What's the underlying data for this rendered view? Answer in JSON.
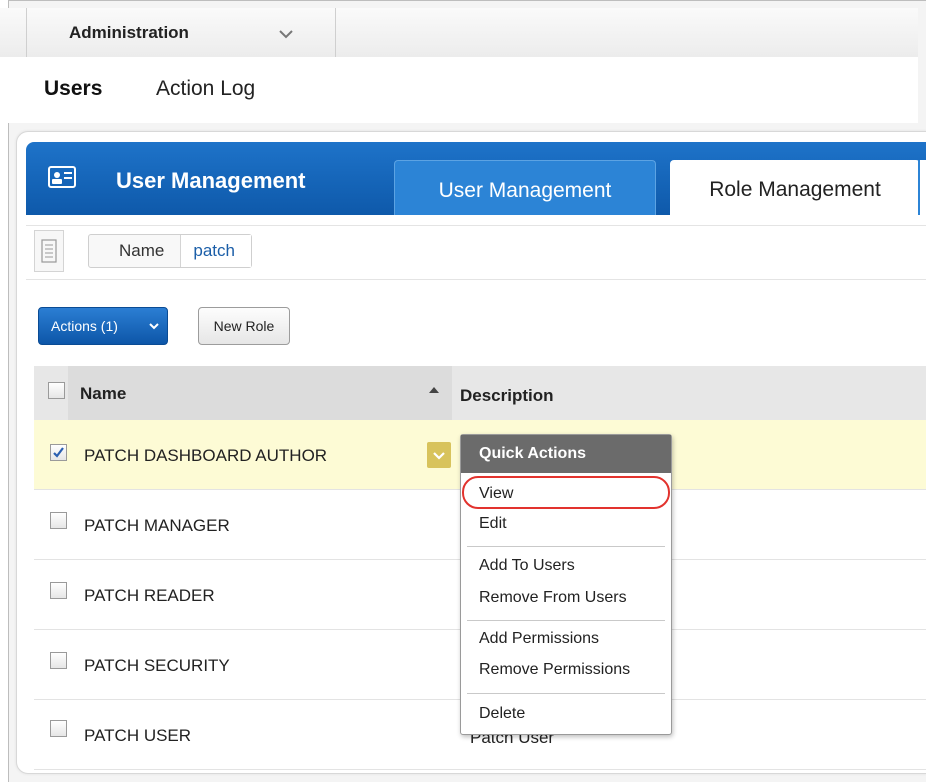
{
  "topbar": {
    "title": "Administration",
    "chevron_icon": "chevron-down-icon"
  },
  "subnav": {
    "tabs": [
      "Users",
      "Action Log"
    ]
  },
  "panel": {
    "title": "User Management",
    "logo_icon": "id-card-icon",
    "tabs": [
      "User Management",
      "Role Management"
    ]
  },
  "filter": {
    "list_icon": "list-icon",
    "key": "Name",
    "value": "patch"
  },
  "toolbar": {
    "actions_label": "Actions (1)",
    "new_role_label": "New Role"
  },
  "table": {
    "headers": [
      "Name",
      "Description"
    ],
    "rows": [
      {
        "name": "PATCH DASHBOARD AUTHOR",
        "description": "",
        "checked": true
      },
      {
        "name": "PATCH MANAGER",
        "description": "",
        "checked": false
      },
      {
        "name": "PATCH READER",
        "description": "",
        "checked": false
      },
      {
        "name": "PATCH SECURITY",
        "description": "",
        "checked": false
      },
      {
        "name": "PATCH USER",
        "description": "Patch User",
        "checked": false
      }
    ]
  },
  "quick_actions": {
    "title": "Quick Actions",
    "items": [
      "View",
      "Edit",
      "Add To Users",
      "Remove From Users",
      "Add Permissions",
      "Remove Permissions",
      "Delete"
    ],
    "highlighted": "View"
  },
  "colors": {
    "brand_blue": "#1367bd",
    "selected_row": "#fdfbd5",
    "highlight": "#e2332e",
    "menu_header": "#6b6b6b"
  }
}
